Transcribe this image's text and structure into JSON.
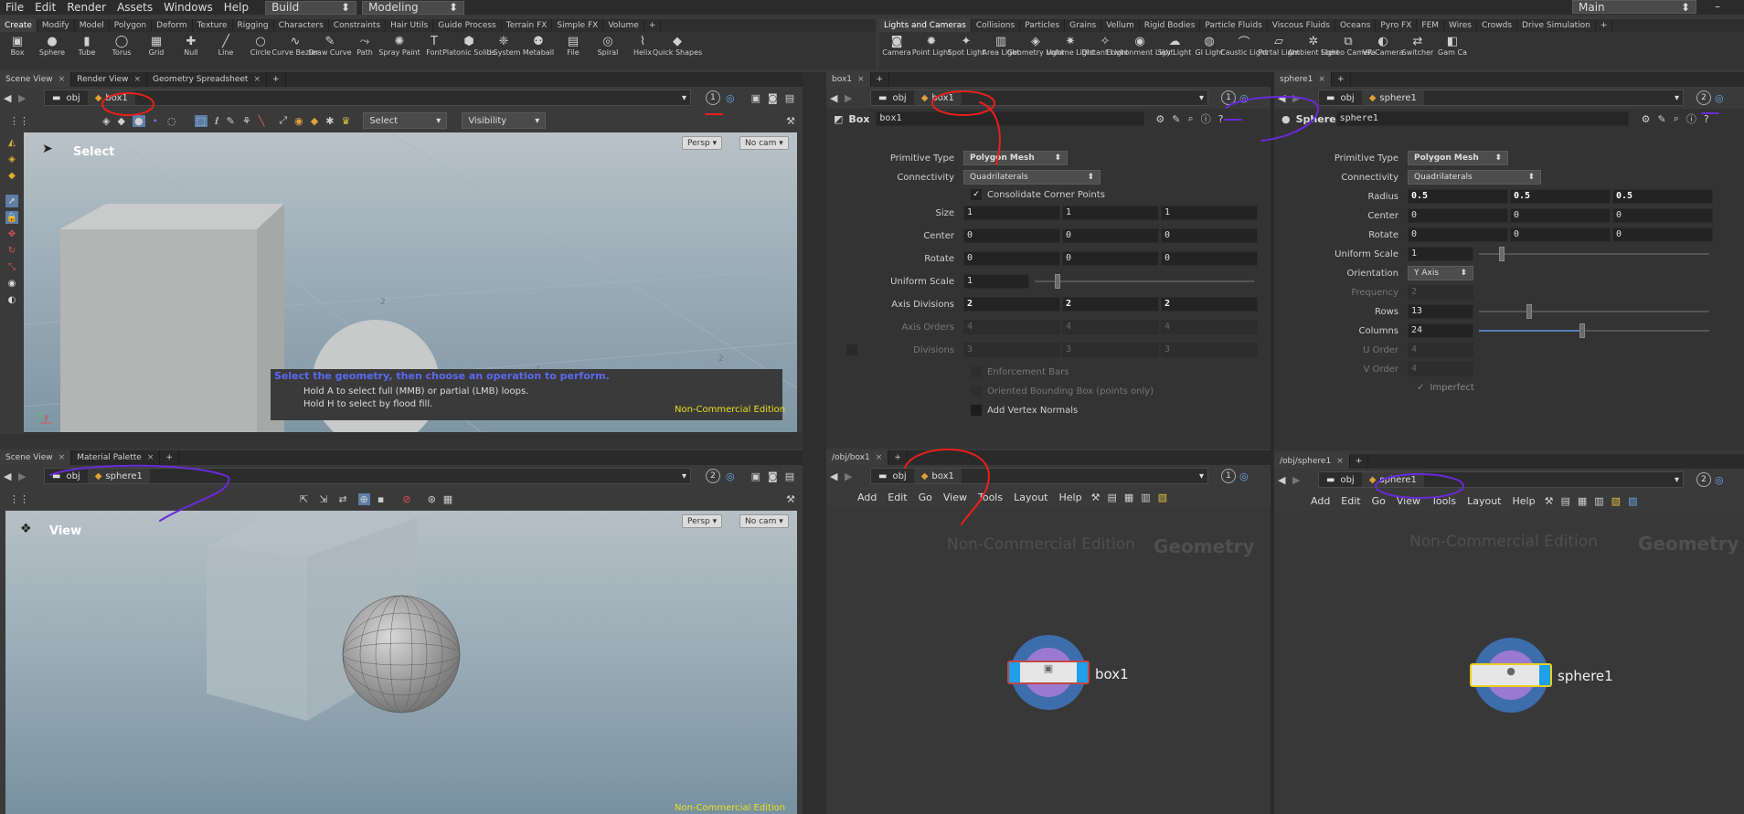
{
  "menubar": {
    "items": [
      "File",
      "Edit",
      "Render",
      "Assets",
      "Windows",
      "Help"
    ],
    "desktop": "Build",
    "workspace": "Modeling",
    "main": "Main"
  },
  "shelf_left": {
    "tabs": [
      "Create",
      "Modify",
      "Model",
      "Polygon",
      "Deform",
      "Texture",
      "Rigging",
      "Characters",
      "Constraints",
      "Hair Utils",
      "Guide Process",
      "Terrain FX",
      "Simple FX",
      "Volume"
    ],
    "tools": [
      {
        "label": "Box",
        "icon": "box-icon"
      },
      {
        "label": "Sphere",
        "icon": "sphere-icon"
      },
      {
        "label": "Tube",
        "icon": "tube-icon"
      },
      {
        "label": "Torus",
        "icon": "torus-icon"
      },
      {
        "label": "Grid",
        "icon": "grid-icon"
      },
      {
        "label": "Null",
        "icon": "null-icon"
      },
      {
        "label": "Line",
        "icon": "line-icon"
      },
      {
        "label": "Circle",
        "icon": "circle-icon"
      },
      {
        "label": "Curve Bezier",
        "icon": "curve-bezier-icon"
      },
      {
        "label": "Draw Curve",
        "icon": "draw-curve-icon"
      },
      {
        "label": "Path",
        "icon": "path-icon"
      },
      {
        "label": "Spray Paint",
        "icon": "spray-paint-icon"
      },
      {
        "label": "Font",
        "icon": "font-icon"
      },
      {
        "label": "Platonic Solids",
        "icon": "platonic-icon"
      },
      {
        "label": "L-System",
        "icon": "lsystem-icon"
      },
      {
        "label": "Metaball",
        "icon": "metaball-icon"
      },
      {
        "label": "File",
        "icon": "file-icon"
      },
      {
        "label": "Spiral",
        "icon": "spiral-icon"
      },
      {
        "label": "Helix",
        "icon": "helix-icon"
      },
      {
        "label": "Quick Shapes",
        "icon": "quick-shapes-icon"
      }
    ]
  },
  "shelf_right": {
    "tabs": [
      "Lights and Cameras",
      "Collisions",
      "Particles",
      "Grains",
      "Vellum",
      "Rigid Bodies",
      "Particle Fluids",
      "Viscous Fluids",
      "Oceans",
      "Pyro FX",
      "FEM",
      "Wires",
      "Crowds",
      "Drive Simulation"
    ],
    "tools": [
      {
        "label": "Camera",
        "icon": "camera-icon"
      },
      {
        "label": "Point Light",
        "icon": "point-light-icon"
      },
      {
        "label": "Spot Light",
        "icon": "spot-light-icon"
      },
      {
        "label": "Area Light",
        "icon": "area-light-icon"
      },
      {
        "label": "Geometry Light",
        "icon": "geometry-light-icon"
      },
      {
        "label": "Volume Light",
        "icon": "volume-light-icon"
      },
      {
        "label": "Distant Light",
        "icon": "distant-light-icon"
      },
      {
        "label": "Environment Light",
        "icon": "environment-light-icon"
      },
      {
        "label": "Sky Light",
        "icon": "sky-light-icon"
      },
      {
        "label": "GI Light",
        "icon": "gi-light-icon"
      },
      {
        "label": "Caustic Light",
        "icon": "caustic-light-icon"
      },
      {
        "label": "Portal Light",
        "icon": "portal-light-icon"
      },
      {
        "label": "Ambient Light",
        "icon": "ambient-light-icon"
      },
      {
        "label": "Stereo Camera",
        "icon": "stereo-camera-icon"
      },
      {
        "label": "VR Camera",
        "icon": "vr-camera-icon"
      },
      {
        "label": "Switcher",
        "icon": "switcher-icon"
      },
      {
        "label": "Gam Ca",
        "icon": "gamepad-camera-icon"
      }
    ]
  },
  "vp_top": {
    "tabs": [
      "Scene View",
      "Render View",
      "Geometry Spreadsheet"
    ],
    "path": [
      "obj",
      "box1"
    ],
    "pin": "1",
    "select": "Select",
    "visibility": "Visibility",
    "state": "Select",
    "persp": "Persp",
    "cam": "No cam",
    "hint": "Select the geometry, then choose an operation to perform.",
    "hint2": "Hold A to select full (MMB) or partial (LMB) loops.",
    "hint3": "Hold H to select by flood fill.",
    "watermark": "Non-Commercial Edition"
  },
  "vp_bottom": {
    "tabs": [
      "Scene View",
      "Material Palette"
    ],
    "path": [
      "obj",
      "sphere1"
    ],
    "pin": "2",
    "state": "View",
    "persp": "Persp",
    "cam": "No cam",
    "watermark": "Non-Commercial Edition"
  },
  "box_params": {
    "tab": "box1",
    "path": [
      "obj",
      "box1"
    ],
    "pin": "1",
    "type": "Box",
    "name": "box1",
    "primitive_type_label": "Primitive Type",
    "primitive_type": "Polygon Mesh",
    "connectivity_label": "Connectivity",
    "connectivity": "Quadrilaterals",
    "consolidate": "Consolidate Corner Points",
    "size_label": "Size",
    "size": [
      "1",
      "1",
      "1"
    ],
    "center_label": "Center",
    "center": [
      "0",
      "0",
      "0"
    ],
    "rotate_label": "Rotate",
    "rotate": [
      "0",
      "0",
      "0"
    ],
    "uscale_label": "Uniform Scale",
    "uscale": "1",
    "axisdiv_label": "Axis Divisions",
    "axisdiv": [
      "2",
      "2",
      "2"
    ],
    "axisorders_label": "Axis Orders",
    "axisorders": [
      "4",
      "4",
      "4"
    ],
    "divisions_label": "Divisions",
    "divisions": [
      "3",
      "3",
      "3"
    ],
    "enforce": "Enforcement Bars",
    "obb": "Oriented Bounding Box (points only)",
    "vnormals": "Add Vertex Normals"
  },
  "sphere_params": {
    "tab": "sphere1",
    "path": [
      "obj",
      "sphere1"
    ],
    "pin": "2",
    "type": "Sphere",
    "name": "sphere1",
    "primitive_type_label": "Primitive Type",
    "primitive_type": "Polygon Mesh",
    "connectivity_label": "Connectivity",
    "connectivity": "Quadrilaterals",
    "radius_label": "Radius",
    "radius": [
      "0.5",
      "0.5",
      "0.5"
    ],
    "center_label": "Center",
    "center": [
      "0",
      "0",
      "0"
    ],
    "rotate_label": "Rotate",
    "rotate": [
      "0",
      "0",
      "0"
    ],
    "uscale_label": "Uniform Scale",
    "uscale": "1",
    "orient_label": "Orientation",
    "orient": "Y Axis",
    "freq_label": "Frequency",
    "freq": "2",
    "rows_label": "Rows",
    "rows": "13",
    "cols_label": "Columns",
    "cols": "24",
    "uorder_label": "U Order",
    "uorder": "4",
    "vorder_label": "V Order",
    "vorder": "4",
    "imperfect": "Imperfect"
  },
  "net_box": {
    "tab": "/obj/box1",
    "path": [
      "obj",
      "box1"
    ],
    "pin": "1",
    "menu": [
      "Add",
      "Edit",
      "Go",
      "View",
      "Tools",
      "Layout",
      "Help"
    ],
    "watermark": "Non-Commercial Edition",
    "context": "Geometry",
    "node": "box1"
  },
  "net_sphere": {
    "tab": "/obj/sphere1",
    "path": [
      "obj",
      "sphere1"
    ],
    "pin": "2",
    "menu": [
      "Add",
      "Edit",
      "Go",
      "View",
      "Tools",
      "Layout",
      "Help"
    ],
    "watermark": "Non-Commercial Edition",
    "context": "Geometry",
    "node": "sphere1"
  },
  "colors": {
    "red": "#e8201c",
    "purple": "#6a2ad8"
  }
}
